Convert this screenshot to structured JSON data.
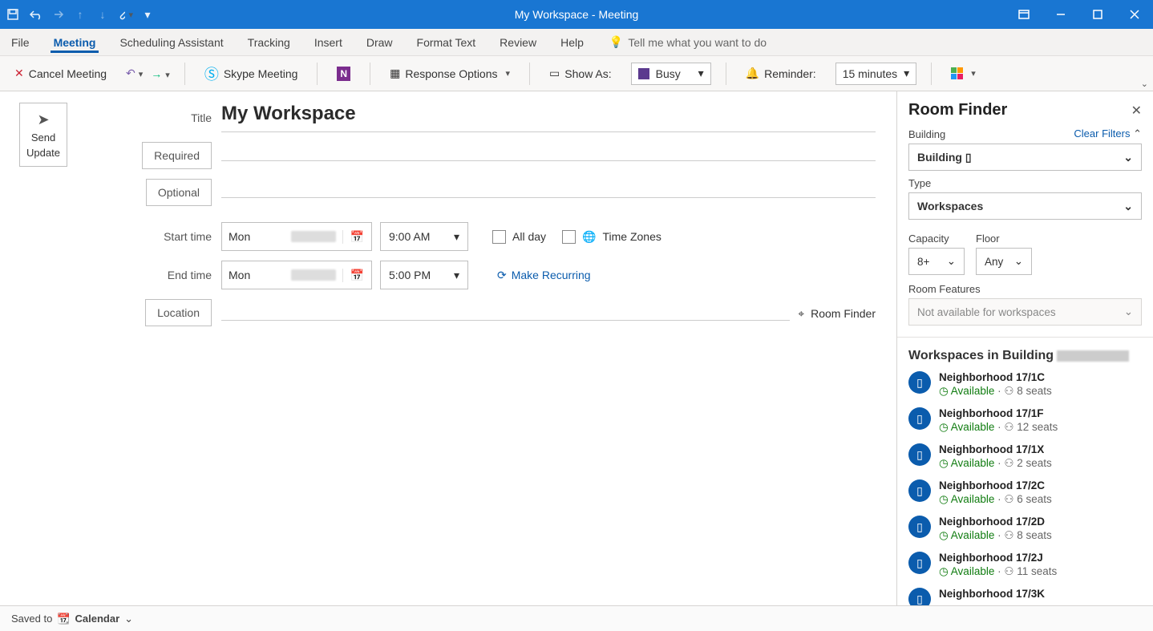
{
  "titlebar": {
    "title": "My Workspace - Meeting"
  },
  "tabs": [
    "File",
    "Meeting",
    "Scheduling Assistant",
    "Tracking",
    "Insert",
    "Draw",
    "Format Text",
    "Review",
    "Help"
  ],
  "tell_me": "Tell me what you want to do",
  "ribbon": {
    "cancel": "Cancel Meeting",
    "skype": "Skype Meeting",
    "response": "Response Options",
    "show_as": "Show As:",
    "busy": "Busy",
    "reminder_lbl": "Reminder:",
    "reminder_val": "15 minutes"
  },
  "send_update": {
    "l1": "Send",
    "l2": "Update"
  },
  "form": {
    "title_lbl": "Title",
    "title_val": "My Workspace",
    "required": "Required",
    "optional": "Optional",
    "start_lbl": "Start time",
    "end_lbl": "End time",
    "start_day": "Mon",
    "end_day": "Mon",
    "start_time": "9:00 AM",
    "end_time": "5:00 PM",
    "all_day": "All day",
    "tz": "Time Zones",
    "recurring": "Make Recurring",
    "location": "Location",
    "room_finder": "Room Finder"
  },
  "panel": {
    "title": "Room Finder",
    "building_lbl": "Building",
    "clear": "Clear Filters",
    "building_val": "Building ▯",
    "type_lbl": "Type",
    "type_val": "Workspaces",
    "capacity_lbl": "Capacity",
    "capacity_val": "8+",
    "floor_lbl": "Floor",
    "floor_val": "Any",
    "features_lbl": "Room Features",
    "features_val": "Not available for workspaces",
    "list_title": "Workspaces in Building",
    "rooms": [
      {
        "name": "Neighborhood 17/1C",
        "status": "Available",
        "seats": "8 seats"
      },
      {
        "name": "Neighborhood 17/1F",
        "status": "Available",
        "seats": "12 seats"
      },
      {
        "name": "Neighborhood 17/1X",
        "status": "Available",
        "seats": "2 seats"
      },
      {
        "name": "Neighborhood 17/2C",
        "status": "Available",
        "seats": "6 seats"
      },
      {
        "name": "Neighborhood 17/2D",
        "status": "Available",
        "seats": "8 seats"
      },
      {
        "name": "Neighborhood 17/2J",
        "status": "Available",
        "seats": "11 seats"
      },
      {
        "name": "Neighborhood 17/3K",
        "status": "",
        "seats": ""
      }
    ]
  },
  "status": {
    "saved_to": "Saved to",
    "calendar": "Calendar"
  }
}
